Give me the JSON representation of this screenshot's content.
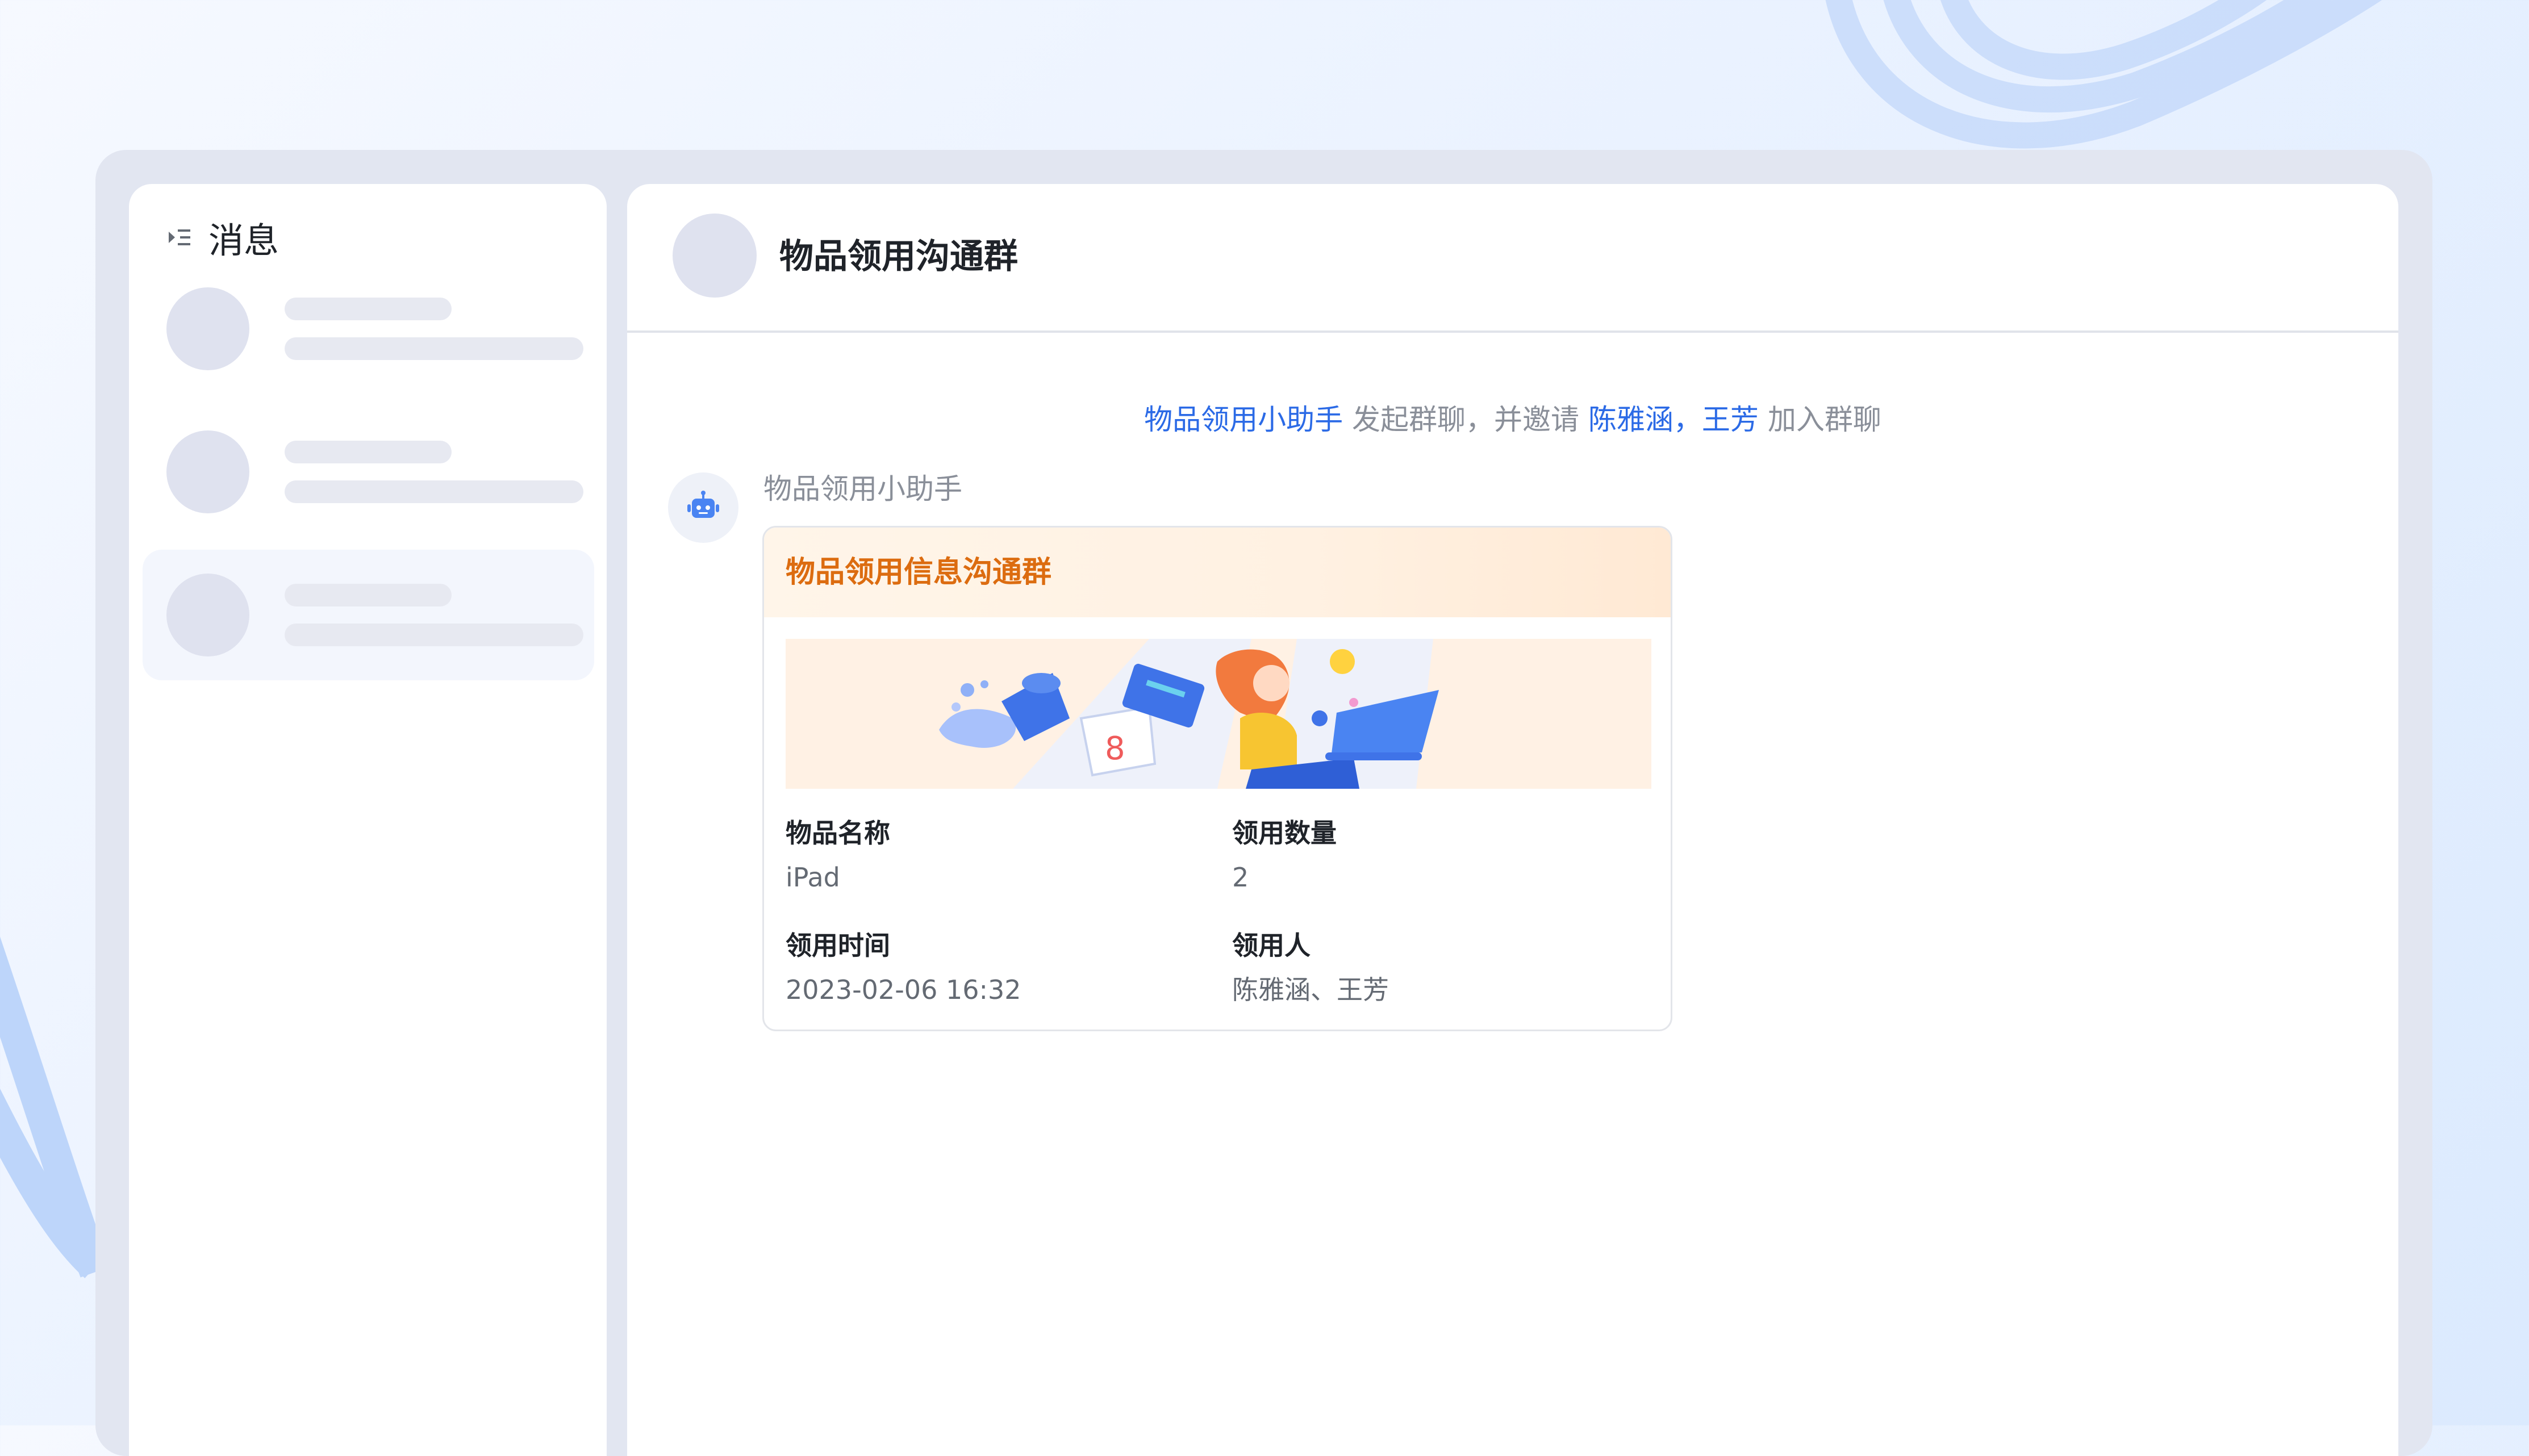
{
  "sidebar": {
    "title": "消息",
    "skeleton_rows": [
      {
        "active": false
      },
      {
        "active": false
      },
      {
        "active": true
      }
    ]
  },
  "chat": {
    "title": "物品领用沟通群",
    "system_message": {
      "initiator": "物品领用小助手",
      "action": " 发起群聊，并邀请 ",
      "invitees": "陈雅涵，王芳",
      "suffix": " 加入群聊"
    },
    "message": {
      "sender": "物品领用小助手",
      "card": {
        "title": "物品领用信息沟通群",
        "fields": [
          {
            "label": "物品名称",
            "value": "iPad"
          },
          {
            "label": "领用数量",
            "value": "2"
          },
          {
            "label": "领用时间",
            "value": "2023-02-06 16:32"
          },
          {
            "label": "领用人",
            "value": "陈雅涵、王芳"
          }
        ]
      }
    }
  },
  "colors": {
    "accent": "#2b6ae6",
    "card_title": "#dc6c10",
    "skeleton": "#dfe2ef"
  },
  "icons": {
    "sidebar_toggle": "list-indent-icon",
    "bot_avatar": "robot-icon"
  }
}
